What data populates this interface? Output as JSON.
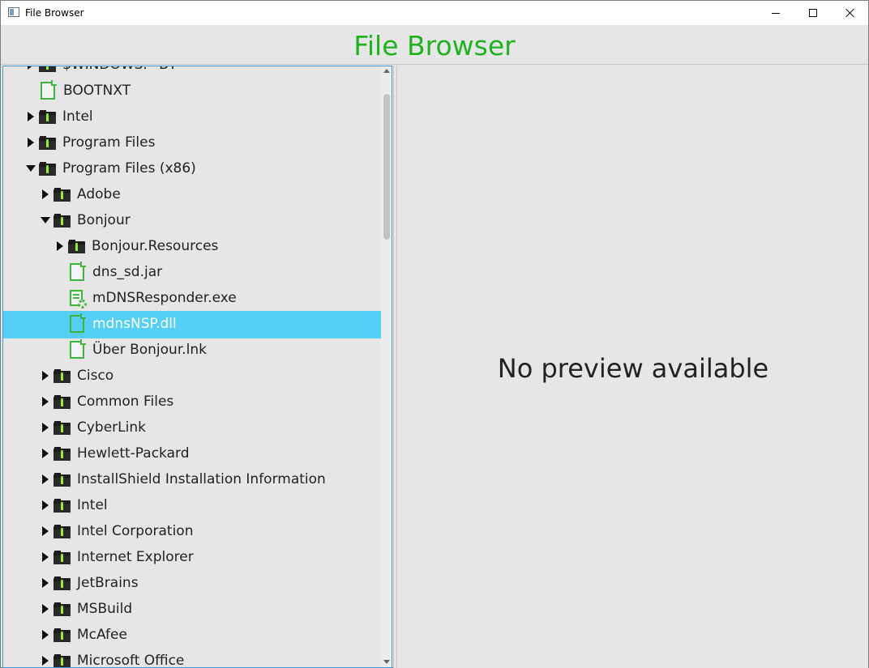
{
  "window": {
    "title": "File Browser"
  },
  "header": {
    "title": "File Browser",
    "title_color": "#1fb31f"
  },
  "preview": {
    "message": "No preview available"
  },
  "colors": {
    "selection": "#55cff5",
    "file_icon": "#3fb43f",
    "folder_accent": "#79e02a"
  },
  "tree": {
    "items": [
      {
        "label": "$WINDOWS.~BT",
        "type": "folder",
        "expanded": false,
        "depth": 1
      },
      {
        "label": "BOOTNXT",
        "type": "file",
        "depth": 1
      },
      {
        "label": "Intel",
        "type": "folder",
        "expanded": false,
        "depth": 1
      },
      {
        "label": "Program Files",
        "type": "folder",
        "expanded": false,
        "depth": 1
      },
      {
        "label": "Program Files (x86)",
        "type": "folder",
        "expanded": true,
        "depth": 1
      },
      {
        "label": "Adobe",
        "type": "folder",
        "expanded": false,
        "depth": 2
      },
      {
        "label": "Bonjour",
        "type": "folder",
        "expanded": true,
        "depth": 2
      },
      {
        "label": "Bonjour.Resources",
        "type": "folder",
        "expanded": false,
        "depth": 3
      },
      {
        "label": "dns_sd.jar",
        "type": "file",
        "depth": 3
      },
      {
        "label": "mDNSResponder.exe",
        "type": "exe",
        "depth": 3
      },
      {
        "label": "mdnsNSP.dll",
        "type": "file",
        "depth": 3,
        "selected": true
      },
      {
        "label": "Über Bonjour.lnk",
        "type": "file",
        "depth": 3
      },
      {
        "label": "Cisco",
        "type": "folder",
        "expanded": false,
        "depth": 2
      },
      {
        "label": "Common Files",
        "type": "folder",
        "expanded": false,
        "depth": 2
      },
      {
        "label": "CyberLink",
        "type": "folder",
        "expanded": false,
        "depth": 2
      },
      {
        "label": "Hewlett-Packard",
        "type": "folder",
        "expanded": false,
        "depth": 2
      },
      {
        "label": "InstallShield Installation Information",
        "type": "folder",
        "expanded": false,
        "depth": 2
      },
      {
        "label": "Intel",
        "type": "folder",
        "expanded": false,
        "depth": 2
      },
      {
        "label": "Intel Corporation",
        "type": "folder",
        "expanded": false,
        "depth": 2
      },
      {
        "label": "Internet Explorer",
        "type": "folder",
        "expanded": false,
        "depth": 2
      },
      {
        "label": "JetBrains",
        "type": "folder",
        "expanded": false,
        "depth": 2
      },
      {
        "label": "MSBuild",
        "type": "folder",
        "expanded": false,
        "depth": 2
      },
      {
        "label": "McAfee",
        "type": "folder",
        "expanded": false,
        "depth": 2
      },
      {
        "label": "Microsoft Office",
        "type": "folder",
        "expanded": false,
        "depth": 2
      }
    ]
  }
}
